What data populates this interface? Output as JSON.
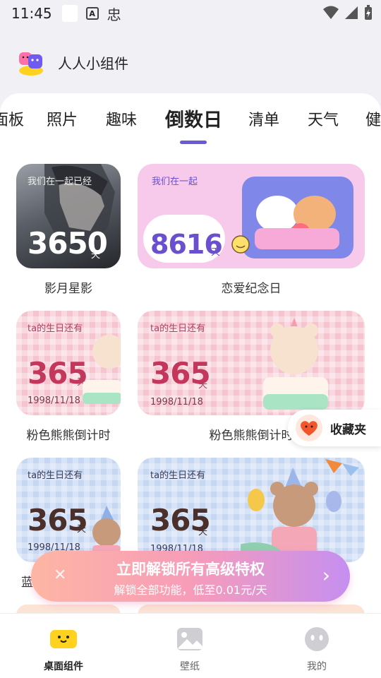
{
  "status_bar": {
    "time": "11:45",
    "a_icon": "A",
    "glyph": "忠"
  },
  "app": {
    "title": "人人小组件"
  },
  "tabs": [
    {
      "label": "面板"
    },
    {
      "label": "照片"
    },
    {
      "label": "趣味"
    },
    {
      "label": "倒数日",
      "active": true
    },
    {
      "label": "清单"
    },
    {
      "label": "天气"
    },
    {
      "label": "健"
    }
  ],
  "cards": {
    "c1": {
      "small": "我们在一起已经",
      "num": "3650",
      "unit": "天",
      "label": "影月星影"
    },
    "c2": {
      "small": "我们在一起",
      "num": "8616",
      "unit": "天",
      "label": "恋爱纪念日"
    },
    "c3": {
      "small": "ta的生日还有",
      "num": "365",
      "unit": "天",
      "date": "1998/11/18",
      "label": "粉色熊熊倒计时"
    },
    "c4": {
      "small": "ta的生日还有",
      "num": "365",
      "unit": "天",
      "date": "1998/11/18",
      "label": "粉色熊熊倒计时"
    },
    "c5": {
      "small": "ta的生日还有",
      "num": "365",
      "unit": "天",
      "date": "1998/11/18",
      "label": "蓝"
    },
    "c6": {
      "small": "ta的生日还有",
      "num": "365",
      "unit": "天",
      "date": "1998/11/18"
    }
  },
  "favorite": {
    "label": "收藏夹"
  },
  "promo": {
    "title": "立即解锁所有高级特权",
    "subtitle": "解锁全部功能，低至0.01元/天",
    "close": "✕",
    "arrow": "›"
  },
  "bottom_nav": [
    {
      "label": "桌面组件",
      "active": true
    },
    {
      "label": "壁纸"
    },
    {
      "label": "我的"
    }
  ],
  "colors": {
    "accent": "#6b5ad6",
    "pink_text": "#c2375b",
    "brown_text": "#4a2f2a"
  }
}
